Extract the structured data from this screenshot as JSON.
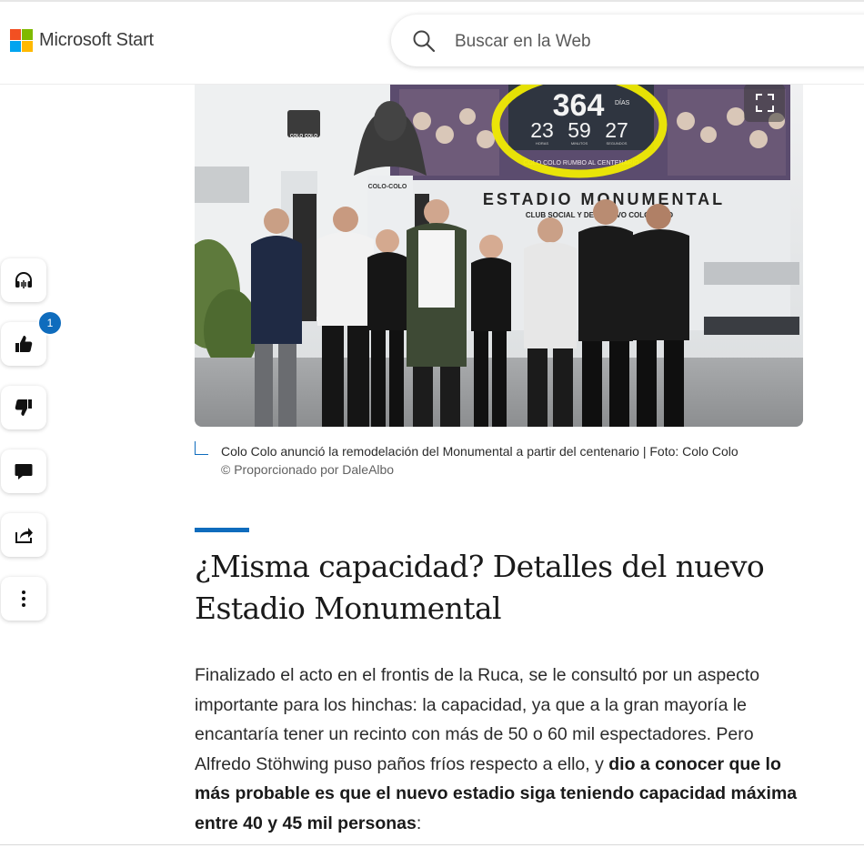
{
  "header": {
    "brand": "Microsoft Start",
    "search_placeholder": "Buscar en la Web",
    "logo_colors": [
      "#f25022",
      "#7fba00",
      "#00a4ef",
      "#ffb900"
    ]
  },
  "rail": {
    "like_count": "1",
    "items": [
      "headphones-icon",
      "thumbs-up-icon",
      "thumbs-down-icon",
      "comment-icon",
      "share-icon",
      "more-icon"
    ]
  },
  "photo": {
    "clock_days": "364",
    "clock_days_label": "DÍAS",
    "clock_hours": "23",
    "clock_minutes": "59",
    "clock_seconds": "27",
    "clock_unit_labels": [
      "HORAS",
      "MINUTOS",
      "SEGUNDOS"
    ],
    "clock_footer": "COLO COLO RUMBO AL CENTENARIO",
    "stadium_sign": "ESTADIO MONUMENTAL",
    "stadium_subsign": "CLUB SOCIAL Y DEPORTIVO COLO-COLO",
    "statue_plaque": "COLO-COLO",
    "crest_text": "COLO COLO",
    "highlight_color": "#f5f000"
  },
  "caption": {
    "text": "Colo Colo anunció la remodelación del Monumental a partir del centenario | Foto: Colo Colo",
    "credit": "© Proporcionado por DaleAlbo"
  },
  "article": {
    "heading": "¿Misma capacidad? Detalles del nuevo Estadio Monumental",
    "paragraph_plain": "Finalizado el acto en el frontis de la Ruca, se le consultó por un aspecto importante para los hinchas: la capacidad, ya que a la gran mayoría le encantaría tener un recinto con más de 50 o 60 mil espectadores. Pero Alfredo Stöhwing puso paños fríos respecto a ello, y ",
    "paragraph_bold": "dio a conocer que lo más probable es que el nuevo estadio siga teniendo capacidad máxima entre 40 y 45 mil personas",
    "paragraph_end": ":"
  }
}
